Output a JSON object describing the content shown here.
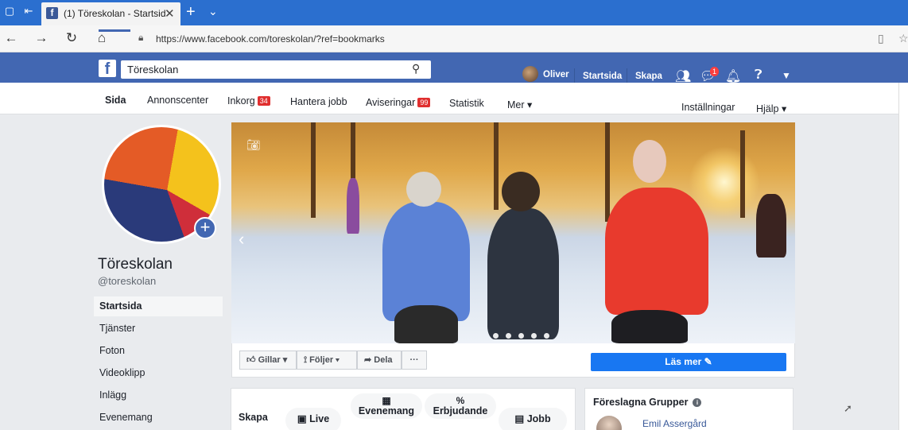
{
  "browser": {
    "tab_title": "(1) Töreskolan - Startsid",
    "tab_close": "✕",
    "new_tab": "+",
    "tab_menu": "⌄",
    "url": "https://www.facebook.com/toreskolan/?ref=bookmarks",
    "back": "←",
    "forward": "→",
    "refresh": "↻",
    "home": "⌂"
  },
  "fb_header": {
    "logo": "f",
    "search_value": "Töreskolan",
    "user": "Oliver",
    "startsida": "Startsida",
    "skapa": "Skapa",
    "messenger_badge": "1"
  },
  "page_tabs": {
    "items": [
      {
        "label": "Sida"
      },
      {
        "label": "Annonscenter"
      },
      {
        "label": "Inkorg",
        "count": "34"
      },
      {
        "label": "Hantera jobb"
      },
      {
        "label": "Aviseringar",
        "count": "99"
      },
      {
        "label": "Statistik"
      },
      {
        "label": "Mer ▾"
      }
    ],
    "settings": "Inställningar",
    "help": "Hjälp ▾"
  },
  "page": {
    "name": "Töreskolan",
    "handle": "@toreskolan"
  },
  "left_nav": [
    "Startsida",
    "Tjänster",
    "Foton",
    "Videoklipp",
    "Inlägg",
    "Evenemang"
  ],
  "actions": {
    "like": "Gillar ▾",
    "follow": "Följer ▾",
    "share": "Dela",
    "more": "···",
    "cta": "Läs mer ✎"
  },
  "create": {
    "label": "Skapa",
    "items": [
      {
        "label": "Live",
        "icon": "video-icon"
      },
      {
        "label": "Evenemang",
        "icon": "calendar-icon"
      },
      {
        "label": "Erbjudande",
        "icon": "percent-icon"
      },
      {
        "label": "Jobb",
        "icon": "briefcase-icon"
      }
    ]
  },
  "suggested": {
    "title": "Föreslagna Grupper",
    "user": "Emil Assergård"
  },
  "colors": {
    "fb_blue": "#4267b2",
    "cta_blue": "#1877f2",
    "badge_red": "#e02f2f"
  }
}
